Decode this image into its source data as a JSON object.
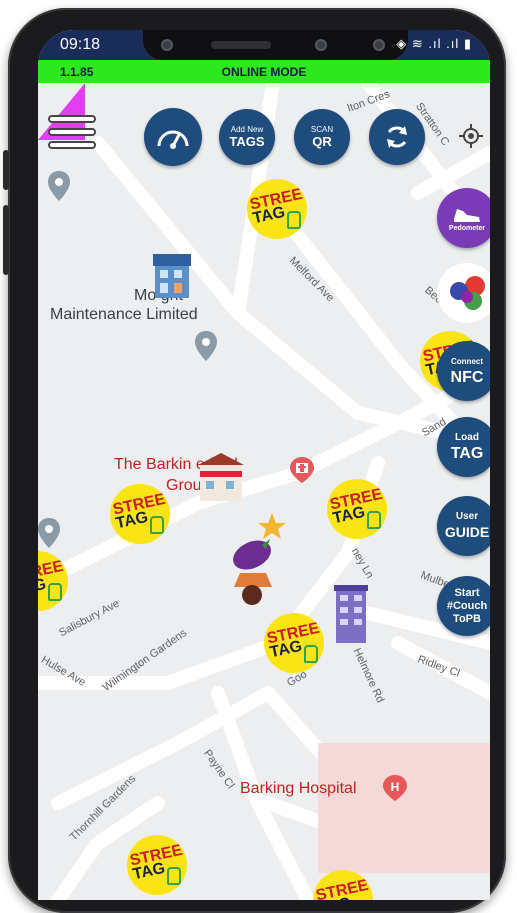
{
  "status_bar": {
    "time": "09:18",
    "icons": "◈ ≋ .ıl .ıl ▮"
  },
  "mode_bar": {
    "version": "1.1.85",
    "mode": "ONLINE MODE"
  },
  "toolbar": {
    "menu_icon": "hamburger-menu-icon",
    "speed_icon": "speedometer-icon",
    "add_tags_small": "Add New",
    "add_tags_big": "TAGS",
    "scan_small": "SCAN",
    "scan_big": "QR",
    "sync_icon": "sync-icon",
    "locate_icon": "crosshair-icon"
  },
  "side_buttons": {
    "pedometer": "Pedometer",
    "nfc_small": "Connect",
    "nfc_big": "NFC",
    "load_small": "Load",
    "load_big": "TAG",
    "guide_small": "User",
    "guide_big": "GUIDE",
    "start_line1": "Start",
    "start_line2": "#Couch",
    "start_line3": "ToPB"
  },
  "tag_badge": {
    "line1": "STREET",
    "line2": "TAG"
  },
  "map": {
    "streets": [
      "Melford Ave",
      "Salisbury Ave",
      "Hulse Ave",
      "Wilmington Gardens",
      "Payne Cl",
      "Thornhill Gardens",
      "Mulberry Ct",
      "Ridley Cl",
      "Helmore Rd",
      "ney Ln",
      "Stratton C",
      "lton Cres",
      "Bec",
      "Sand",
      "Goo"
    ],
    "pois": {
      "maintenance_line1": "Mo          ght",
      "maintenance_line2": "Maintenance Limited",
      "medical_line1": "The Barkin          edical",
      "medical_line2": "Grou          ctice",
      "hospital": "Barking Hospital"
    }
  },
  "colors": {
    "accent": "#1d4c7d",
    "mode_bar": "#2ee81e",
    "tag_yellow": "#fbe415",
    "tag_red": "#cf1a2c"
  }
}
